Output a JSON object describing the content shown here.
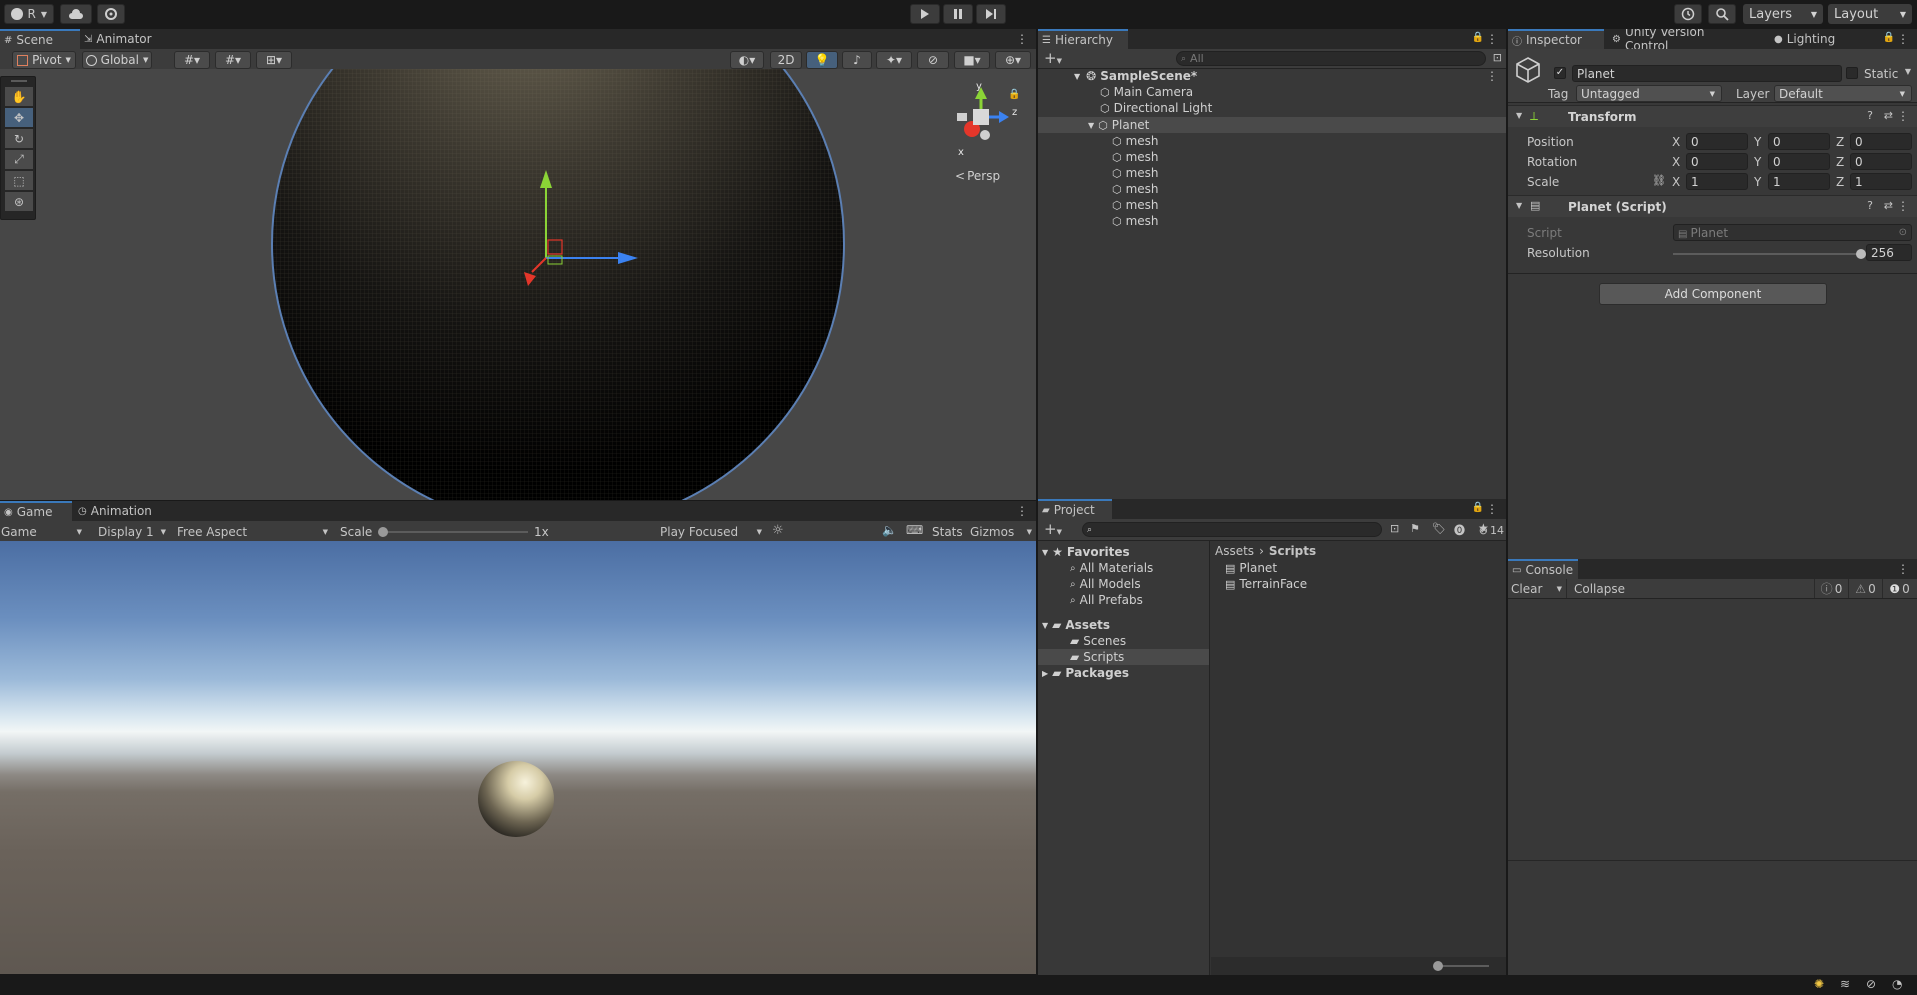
{
  "toolbar": {
    "account_label": "R",
    "layers_label": "Layers",
    "layout_label": "Layout"
  },
  "scene": {
    "tabs": [
      {
        "label": "Scene"
      },
      {
        "label": "Animator"
      }
    ],
    "pivot_label": "Pivot",
    "global_label": "Global",
    "mode_2d": "2D",
    "persp_label": "Persp",
    "axes": {
      "x": "x",
      "y": "y",
      "z": "z"
    }
  },
  "game": {
    "tabs": [
      {
        "label": "Game"
      },
      {
        "label": "Animation"
      }
    ],
    "game_dropdown": "Game",
    "display": "Display 1",
    "aspect": "Free Aspect",
    "scale_label": "Scale",
    "scale_value": "1x",
    "play_mode": "Play Focused",
    "stats_label": "Stats",
    "gizmos_label": "Gizmos"
  },
  "hierarchy": {
    "tab": "Hierarchy",
    "search_placeholder": "All",
    "scene_name": "SampleScene*",
    "items": [
      {
        "label": "Main Camera"
      },
      {
        "label": "Directional Light"
      },
      {
        "label": "Planet"
      }
    ],
    "children": [
      {
        "label": "mesh"
      },
      {
        "label": "mesh"
      },
      {
        "label": "mesh"
      },
      {
        "label": "mesh"
      },
      {
        "label": "mesh"
      },
      {
        "label": "mesh"
      }
    ]
  },
  "project": {
    "tab": "Project",
    "hidden_count": "14",
    "favorites_label": "Favorites",
    "favorites": [
      {
        "label": "All Materials"
      },
      {
        "label": "All Models"
      },
      {
        "label": "All Prefabs"
      }
    ],
    "assets_label": "Assets",
    "asset_folders": [
      {
        "label": "Scenes"
      },
      {
        "label": "Scripts"
      }
    ],
    "packages_label": "Packages",
    "breadcrumb_root": "Assets",
    "breadcrumb_current": "Scripts",
    "files": [
      {
        "label": "Planet"
      },
      {
        "label": "TerrainFace"
      }
    ]
  },
  "inspector": {
    "tabs": [
      {
        "label": "Inspector"
      },
      {
        "label": "Unity Version Control"
      },
      {
        "label": "Lighting"
      }
    ],
    "object_name": "Planet",
    "static_label": "Static",
    "tag_label": "Tag",
    "tag_value": "Untagged",
    "layer_label": "Layer",
    "layer_value": "Default",
    "transform_title": "Transform",
    "position_label": "Position",
    "rotation_label": "Rotation",
    "scale_label": "Scale",
    "axis_x": "X",
    "axis_y": "Y",
    "axis_z": "Z",
    "position": {
      "x": "0",
      "y": "0",
      "z": "0"
    },
    "rotation": {
      "x": "0",
      "y": "0",
      "z": "0"
    },
    "scale": {
      "x": "1",
      "y": "1",
      "z": "1"
    },
    "script_component_title": "Planet (Script)",
    "script_label": "Script",
    "script_value": "Planet",
    "resolution_label": "Resolution",
    "resolution_value": "256",
    "resolution_fraction": 1.0,
    "add_component_label": "Add Component"
  },
  "console": {
    "tab": "Console",
    "clear_label": "Clear",
    "collapse_label": "Collapse",
    "info_count": "0",
    "warn_count": "0",
    "error_count": "0"
  },
  "colors": {
    "accent": "#3a79bb",
    "axis_x": "#e4362a",
    "axis_y": "#8bd436",
    "axis_z": "#3b82f0"
  }
}
